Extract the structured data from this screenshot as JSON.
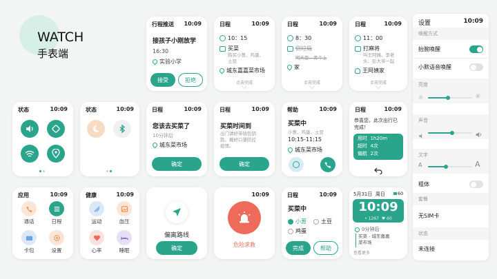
{
  "brand": {
    "title": "WATCH",
    "subtitle": "手表端"
  },
  "colors": {
    "accent": "#2aa58b",
    "red": "#ee6a5a",
    "orange": "#f6a06a"
  },
  "common": {
    "time": "10:09"
  },
  "c1": {
    "header": "行程推送",
    "title": "接孩子小刚放学",
    "time": "16:30",
    "place": "实验小学",
    "accept": "接受",
    "reject": "拒绝"
  },
  "c2": {
    "header": "日程",
    "time": "10：15",
    "task": "买菜",
    "note_a": "购买小葱、鸡蛋、",
    "note_b": "土豆",
    "place": "城东嘉嘉菜市场",
    "footer": "点击完成"
  },
  "c3": {
    "header": "日程",
    "time": "8：30",
    "task": "倒垃圾",
    "note": "明天是…青今上",
    "place": "家",
    "footer": "点击完成"
  },
  "c4": {
    "header": "日程",
    "time": "11：00",
    "task": "打麻将",
    "note_a": "叫王阿姨、李老",
    "note_b": "头、彭大爷一起",
    "person": "王阿姨家",
    "footer": "点击完成"
  },
  "s1": {
    "header": "状态",
    "icons": [
      "volume-icon",
      "rotate-icon",
      "wifi-icon",
      "location-icon"
    ]
  },
  "s2": {
    "header": "状态",
    "icons": [
      "moon-icon",
      "bluetooth-icon"
    ]
  },
  "r1": {
    "header": "日程",
    "title": "您该去买菜了",
    "sub": "10分钟后",
    "place": "城东菜市场",
    "button": "确定"
  },
  "r2": {
    "header": "日程",
    "title": "买菜时间到",
    "body_a": "出门请好带钱包钥",
    "body_b": "匙、戴好口罩防控",
    "body_c": "疫情。",
    "button": "确定"
  },
  "h1": {
    "header": "帮助",
    "title": "买菜中",
    "names": "小葱、鸡蛋、土豆",
    "time": "10:15-11:15",
    "place": "城东菜市场"
  },
  "sc": {
    "header": "日程",
    "line_a": "恭喜您，此次出行已",
    "line_b": "完成！",
    "stats": [
      {
        "k": "用时",
        "v": "1h20m"
      },
      {
        "k": "超时",
        "v": "4次"
      },
      {
        "k": "偏航",
        "v": "2次"
      }
    ]
  },
  "a1": {
    "header": "应用",
    "apps": [
      {
        "name": "通话"
      },
      {
        "name": "日程"
      },
      {
        "name": "卡包"
      },
      {
        "name": "设置"
      }
    ]
  },
  "a2": {
    "header": "健康",
    "apps": [
      {
        "name": "运动"
      },
      {
        "name": "血压"
      },
      {
        "name": "心率"
      },
      {
        "name": "睡眠"
      }
    ]
  },
  "dev": {
    "label": "偏离路线",
    "button": "确定"
  },
  "sos": {
    "label": "危险求救"
  },
  "chk": {
    "header": "日程",
    "title": "买菜中",
    "items": [
      {
        "name": "小葱",
        "done": true
      },
      {
        "name": "土豆",
        "done": false
      },
      {
        "name": "鸡蛋",
        "done": false
      }
    ],
    "done": "完成",
    "help": "帮助"
  },
  "wf": {
    "date": "5月31日",
    "day": "周日",
    "battery": "60",
    "big_time": "10:09",
    "steps": "1267",
    "heart": "60",
    "countdown": "0分钟后",
    "task_a": "买菜 - 城东嘉嘉",
    "task_b": "菜市场",
    "more": "查看更多"
  },
  "set": {
    "title": "设置",
    "time": "10:09",
    "sec_wake": "唤醒方式",
    "raise": "抬腕唤醒",
    "voice": "小默语音唤醒",
    "sec_bright": "亮度",
    "brightness": 0.45,
    "sec_sound": "声音",
    "volume": 0.55,
    "sec_text": "文字",
    "font_small": "A",
    "font_big": "A",
    "font_size": 0.4,
    "bold": "粗体",
    "sec_sim": "套餐",
    "sim": "无SIM卡",
    "sec_state": "状态",
    "conn": "未连接"
  }
}
